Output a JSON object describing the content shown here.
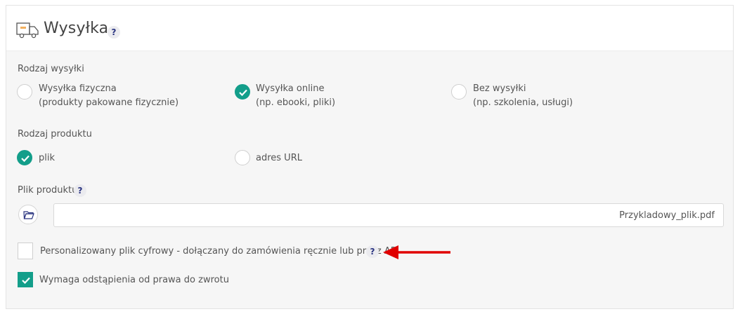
{
  "header": {
    "title": "Wysyłka",
    "help": "?"
  },
  "shipping_type": {
    "label": "Rodzaj wysyłki",
    "options": [
      {
        "title": "Wysyłka fizyczna",
        "subtitle": "(produkty pakowane fizycznie)",
        "selected": false
      },
      {
        "title": "Wysyłka online",
        "subtitle": "(np. ebooki, pliki)",
        "selected": true
      },
      {
        "title": "Bez wysyłki",
        "subtitle": "(np. szkolenia, usługi)",
        "selected": false
      }
    ]
  },
  "product_type": {
    "label": "Rodzaj produktu",
    "options": [
      {
        "title": "plik",
        "selected": true
      },
      {
        "title": "adres URL",
        "selected": false
      }
    ]
  },
  "product_file": {
    "label": "Plik produktu",
    "help": "?",
    "value": "Przykladowy_plik.pdf"
  },
  "checkboxes": {
    "personalized": {
      "label": "Personalizowany plik cyfrowy - dołączany do zamówienia ręcznie lub przez API",
      "help": "?",
      "checked": false
    },
    "withdrawal": {
      "label": "Wymaga odstąpienia od prawa do zwrotu",
      "checked": true
    }
  },
  "colors": {
    "accent": "#139e8a",
    "help_text": "#2a3480",
    "arrow": "#e00000"
  }
}
